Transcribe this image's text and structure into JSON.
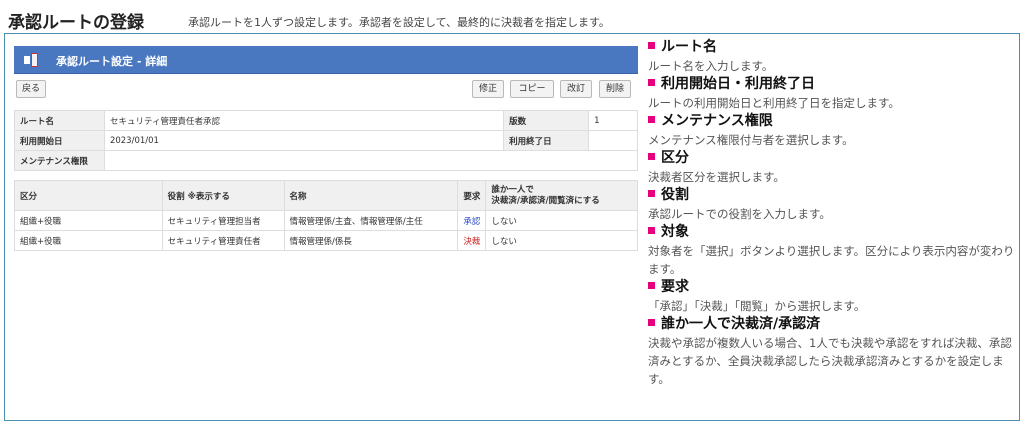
{
  "page": {
    "title": "承認ルートの登録",
    "subtitle": "承認ルートを1人ずつ設定します。承認者を設定して、最終的に決裁者を指定します。"
  },
  "panel": {
    "title": "承認ルート設定 - 詳細",
    "icon": "route-icon",
    "accent_color": "#4a78c0"
  },
  "toolbar": {
    "back": "戻る",
    "edit": "修正",
    "copy": "コピー",
    "revise": "改訂",
    "delete": "削除"
  },
  "route_info": {
    "route_name_label": "ルート名",
    "route_name_value": "セキュリティ管理責任者承認",
    "version_label": "版数",
    "version_value": "1",
    "start_label": "利用開始日",
    "start_value": "2023/01/01",
    "end_label": "利用終了日",
    "end_value": "",
    "maint_label": "メンテナンス権限",
    "maint_value": ""
  },
  "steps": {
    "headers": [
      "区分",
      "役割 ※表示する",
      "名称",
      "要求",
      "誰か一人で\n決裁済/承認済/閲覧済にする"
    ],
    "rows": [
      [
        "組織+役職",
        "セキュリティ管理担当者",
        "情報管理係/主査、情報管理係/主任",
        "承認",
        "しない"
      ],
      [
        "組織+役職",
        "セキュリティ管理責任者",
        "情報管理係/係長",
        "決裁",
        "しない"
      ]
    ]
  },
  "descriptions": [
    {
      "title": "ルート名",
      "text": "ルート名を入力します。"
    },
    {
      "title": "利用開始日・利用終了日",
      "text": "ルートの利用開始日と利用終了日を指定します。"
    },
    {
      "title": "メンテナンス権限",
      "text": "メンテナンス権限付与者を選択します。"
    },
    {
      "title": "区分",
      "text": "決裁者区分を選択します。"
    },
    {
      "title": "役割",
      "text": "承認ルートでの役割を入力します。"
    },
    {
      "title": "対象",
      "text": "対象者を「選択」ボタンより選択します。区分により表示内容が変わります。"
    },
    {
      "title": "要求",
      "text": "「承認」「決裁」「閲覧」から選択します。"
    },
    {
      "title": "誰か一人で決裁済/承認済",
      "text": "決裁や承認が複数人いる場合、1人でも決裁や承認をすれば決裁、承認済みとするか、全員決裁承認したら決裁承認済みとするかを設定します。"
    }
  ]
}
